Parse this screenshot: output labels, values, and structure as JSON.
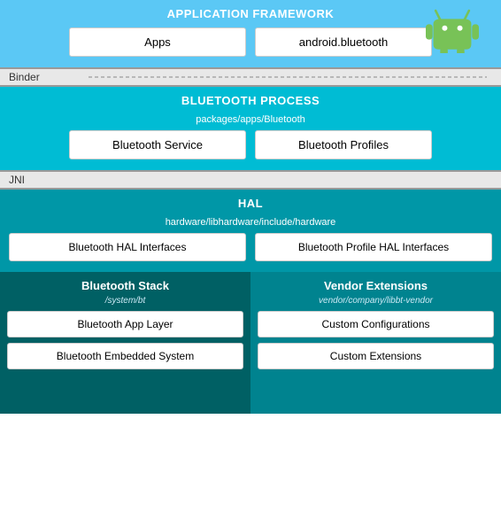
{
  "android_logo_color": "#78c257",
  "sections": {
    "app_framework": {
      "title": "APPLICATION FRAMEWORK",
      "boxes": [
        "Apps",
        "android.bluetooth"
      ]
    },
    "binder": "Binder",
    "bt_process": {
      "title": "BLUETOOTH PROCESS",
      "subtitle": "packages/apps/Bluetooth",
      "box1": "Bluetooth Service",
      "box2": "Bluetooth Profiles"
    },
    "jni": "JNI",
    "hal": {
      "title": "HAL",
      "subtitle": "hardware/libhardware/include/hardware",
      "box1": "Bluetooth HAL Interfaces",
      "box2": "Bluetooth Profile HAL Interfaces"
    },
    "bt_stack": {
      "title": "Bluetooth Stack",
      "subtitle": "/system/bt",
      "box1": "Bluetooth App Layer",
      "box2": "Bluetooth Embedded System"
    },
    "vendor": {
      "title": "Vendor Extensions",
      "subtitle": "vendor/company/libbt-vendor",
      "box1": "Custom Configurations",
      "box2": "Custom Extensions"
    }
  }
}
